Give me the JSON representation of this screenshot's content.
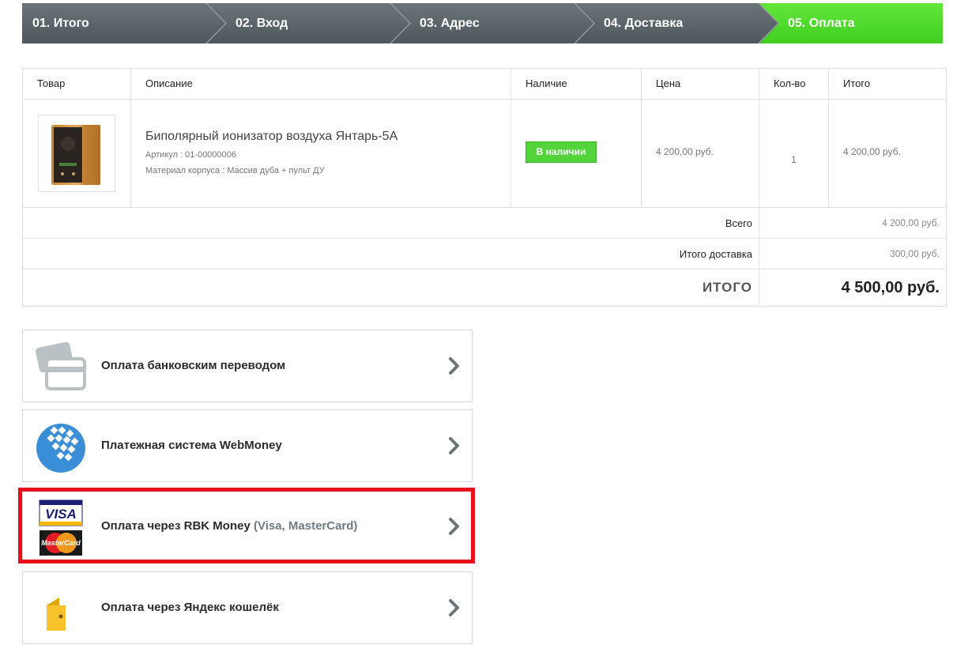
{
  "steps": [
    {
      "label": "01. Итого",
      "active": false
    },
    {
      "label": "02. Вход",
      "active": false
    },
    {
      "label": "03. Адрес",
      "active": false
    },
    {
      "label": "04. Доставка",
      "active": false
    },
    {
      "label": "05. Оплата",
      "active": true
    }
  ],
  "colors": {
    "step_inactive": "#5b6569",
    "step_active": "#4fdc2b",
    "badge_green": "#53d43a",
    "highlight_red": "#e8101a"
  },
  "cart": {
    "headers": {
      "product": "Товар",
      "description": "Описание",
      "availability": "Наличие",
      "price": "Цена",
      "qty": "Кол-во",
      "total": "Итого"
    },
    "item": {
      "title": "Биполярный ионизатор воздуха Янтарь-5А",
      "sku": "Артикул : 01-00000006",
      "material": "Материал корпуса : Массив дуба + пульт ДУ",
      "availability": "В наличии",
      "price": "4 200,00 руб.",
      "qty": "1",
      "total": "4 200,00 руб."
    },
    "summary": {
      "subtotal_label": "Всего",
      "subtotal_value": "4 200,00 руб.",
      "delivery_label": "Итого доставка",
      "delivery_value": "300,00 руб.",
      "grand_label": "ИТОГО",
      "grand_value": "4 500,00 руб."
    }
  },
  "payments": [
    {
      "label": "Оплата банковским переводом",
      "sub": "",
      "icon": "bank-card-icon"
    },
    {
      "label": "Платежная система WebMoney",
      "sub": "",
      "icon": "webmoney-icon"
    },
    {
      "label": "Оплата через RBK Money",
      "sub": "(Visa, MasterCard)",
      "icon": "visa-mastercard-icon",
      "highlighted": true
    },
    {
      "label": "Оплата через Яндекс кошелёк",
      "sub": "",
      "icon": "yandex-wallet-icon"
    }
  ],
  "logos": {
    "visa": "VISA",
    "mastercard": "MasterCard"
  }
}
